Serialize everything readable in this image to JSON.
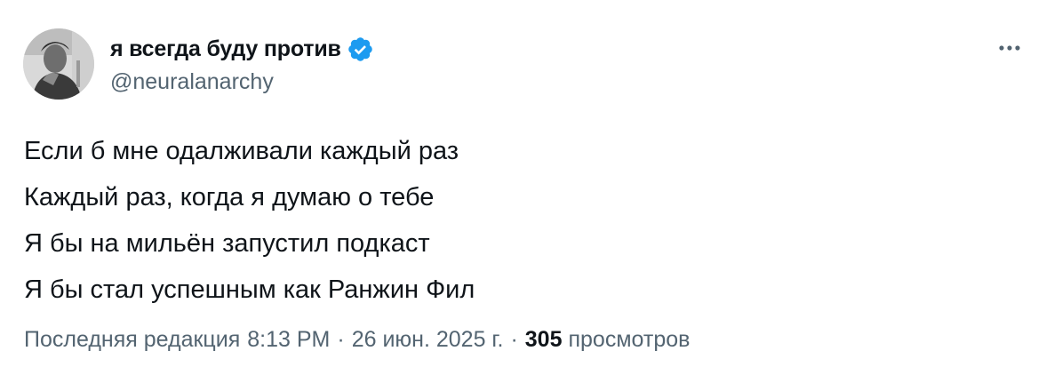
{
  "author": {
    "display_name": "я всегда буду против",
    "handle": "@neuralanarchy",
    "verified_icon": "verified-badge-icon",
    "verified_color": "#1d9bf0"
  },
  "menu_icon": "more-horizontal-icon",
  "tweet": {
    "lines": [
      "Если б мне одалживали каждый раз",
      "Каждый раз, когда я думаю о тебе",
      "Я бы на мильён запустил подкаст",
      "Я бы стал успешным как Ранжин Фил"
    ]
  },
  "meta": {
    "edited_label": "Последняя редакция",
    "time": "8:13 PM",
    "separator": "·",
    "date": "26 июн. 2025 г.",
    "views_count": "305",
    "views_label": "просмотров"
  }
}
